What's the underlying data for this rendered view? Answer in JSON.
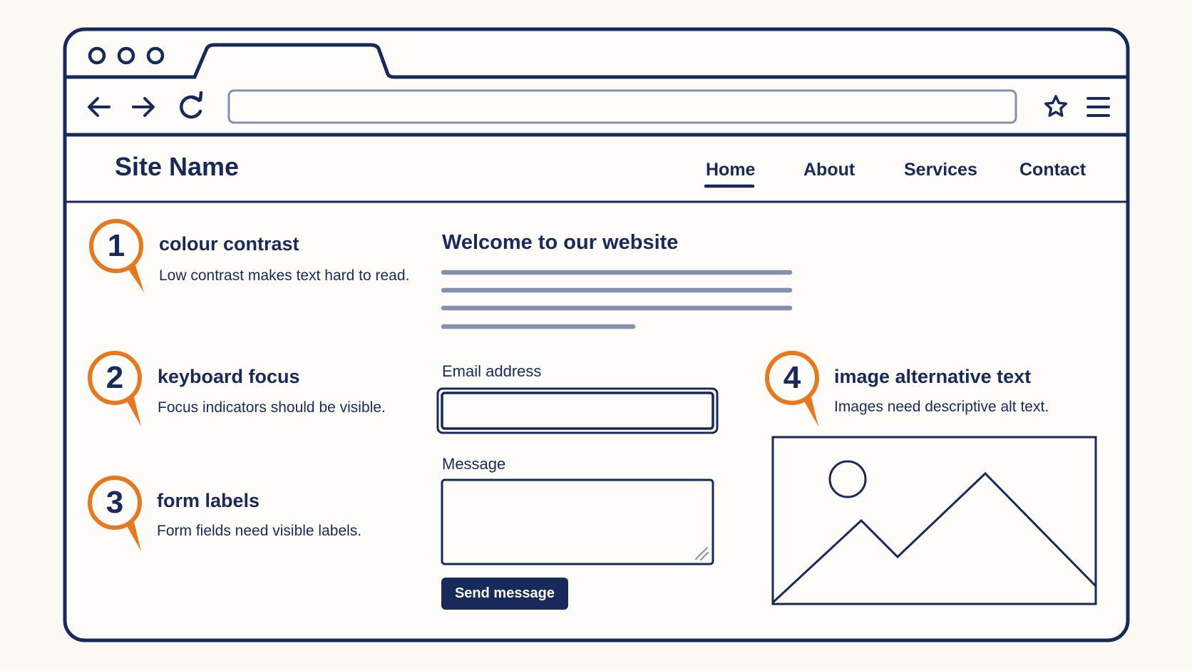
{
  "colors": {
    "ink": "#172a5a",
    "accent_orange": "#e7781e",
    "line_gray": "#8590ad",
    "background": "#fbf9f4"
  },
  "browser": {
    "window_controls": [
      "circle-icon",
      "circle-icon",
      "circle-icon"
    ],
    "toolbar_icons": [
      "arrow-left-icon",
      "arrow-right-icon",
      "refresh-icon",
      "star-icon",
      "hamburger-menu-icon"
    ]
  },
  "site": {
    "name": "Site Name",
    "nav": [
      {
        "label": "Home",
        "active": true
      },
      {
        "label": "About",
        "active": false
      },
      {
        "label": "Services",
        "active": false
      },
      {
        "label": "Contact",
        "active": false
      }
    ]
  },
  "content": {
    "heading": "Welcome to our website",
    "email_label": "Email address",
    "message_label": "Message",
    "send_label": "Send message"
  },
  "annotations": [
    {
      "number": "1",
      "title": "colour contrast",
      "description": "Low contrast makes text hard to read."
    },
    {
      "number": "2",
      "title": "keyboard focus",
      "description": "Focus indicators should be visible."
    },
    {
      "number": "3",
      "title": "form labels",
      "description": "Form fields need visible labels."
    },
    {
      "number": "4",
      "title": "image alternative text",
      "description": "Images need descriptive alt text."
    }
  ]
}
